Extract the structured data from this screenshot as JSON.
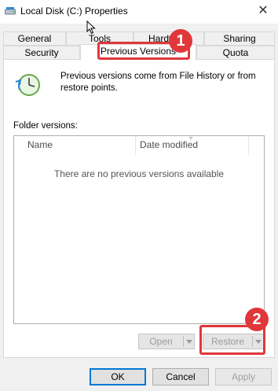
{
  "window": {
    "title": "Local Disk (C:) Properties",
    "icons": {
      "app": "drive-icon",
      "close": "close-icon"
    }
  },
  "tabs": {
    "row1": [
      {
        "label": "General"
      },
      {
        "label": "Tools"
      },
      {
        "label": "Hardware"
      },
      {
        "label": "Sharing"
      }
    ],
    "row2": [
      {
        "label": "Security"
      },
      {
        "label": "Previous Versions",
        "active": true
      },
      {
        "label": "Quota"
      }
    ]
  },
  "panel": {
    "description": "Previous versions come from File History or from restore points.",
    "icon": "clock-restore-icon",
    "folder_versions_label": "Folder versions:",
    "columns": [
      {
        "label": "Name"
      },
      {
        "label": "Date modified"
      }
    ],
    "empty_message": "There are no previous versions available",
    "open_label": "Open",
    "restore_label": "Restore"
  },
  "footer": {
    "ok_label": "OK",
    "cancel_label": "Cancel",
    "apply_label": "Apply"
  },
  "annotations": {
    "badge1": "1",
    "badge2": "2",
    "color": "#e0373a"
  }
}
